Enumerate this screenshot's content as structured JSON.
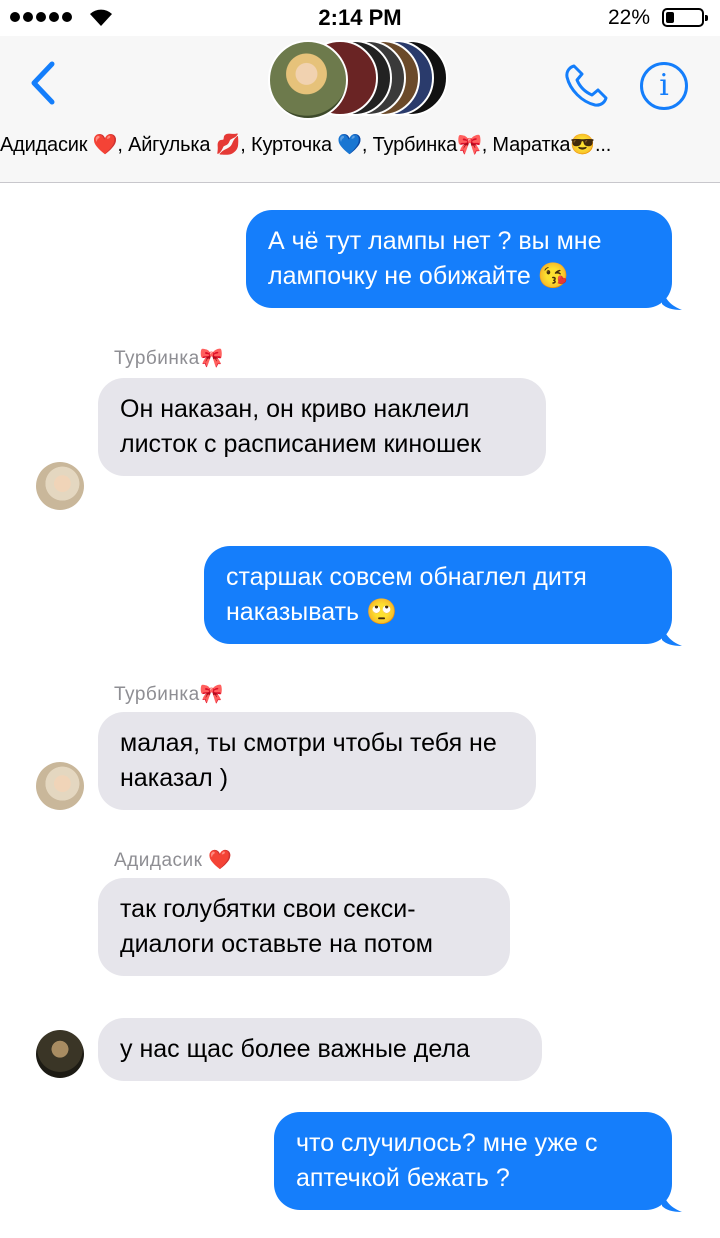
{
  "status": {
    "time": "2:14 PM",
    "battery": "22%"
  },
  "header": {
    "group_names": "Адидасик ❤️, Айгулька 💋, Курточка 💙, Турбинка🎀, Маратка😎..."
  },
  "icons": {
    "back": "chevron-left-icon",
    "call": "phone-icon",
    "info": "info-icon"
  },
  "colors": {
    "accent": "#157efb",
    "incoming": "#e6e5eb",
    "sender": "#8e8e93"
  },
  "messages": [
    {
      "dir": "out",
      "text": "А чё тут лампы нет ? вы мне лампочку не обижайте 😘"
    },
    {
      "dir": "in",
      "sender": "Турбинка🎀",
      "text": "Он наказан, он криво наклеил листок с расписанием киношек"
    },
    {
      "dir": "out",
      "text": "старшак совсем обнаглел дитя наказывать 🙄"
    },
    {
      "dir": "in",
      "sender": "Турбинка🎀",
      "text": "малая, ты смотри чтобы тебя не наказал )"
    },
    {
      "dir": "in",
      "sender": "Адидасик ❤️",
      "text": "так голубятки свои секси-диалоги оставьте на потом"
    },
    {
      "dir": "in",
      "text": "у нас щас более важные дела"
    },
    {
      "dir": "out",
      "text": "что случилось? мне уже с аптечкой бежать ?"
    }
  ]
}
